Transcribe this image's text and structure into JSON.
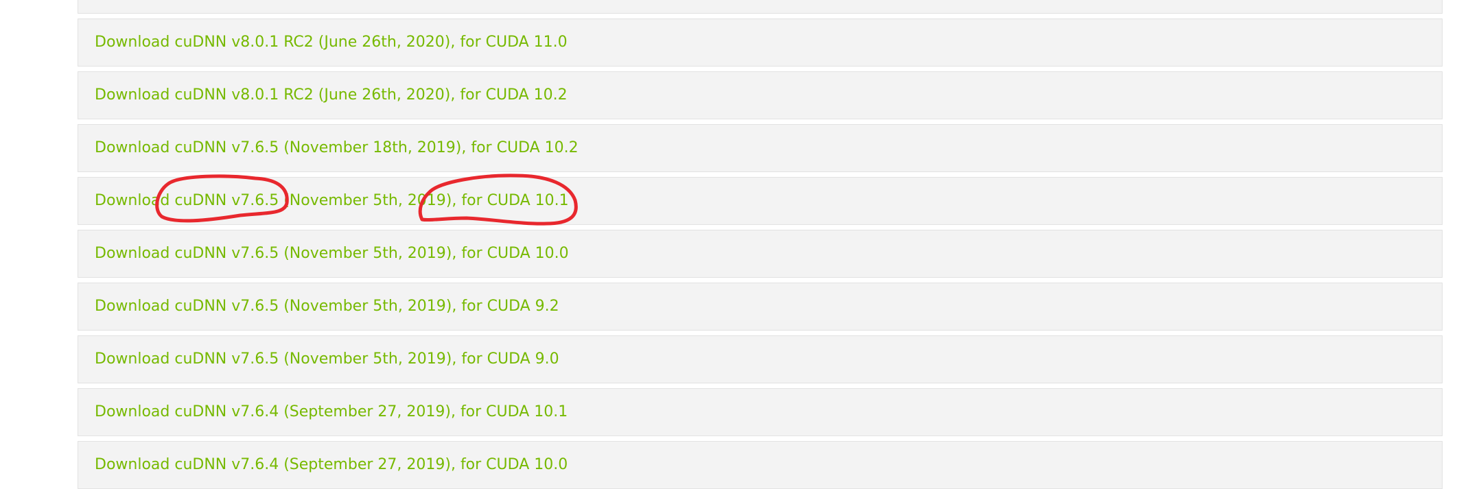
{
  "downloads": [
    {
      "label": ""
    },
    {
      "label": "Download cuDNN v8.0.1 RC2 (June 26th, 2020), for CUDA 11.0"
    },
    {
      "label": "Download cuDNN v8.0.1 RC2 (June 26th, 2020), for CUDA 10.2"
    },
    {
      "label": "Download cuDNN v7.6.5 (November 18th, 2019), for CUDA 10.2"
    },
    {
      "label": "Download cuDNN v7.6.5 (November 5th, 2019), for CUDA 10.1"
    },
    {
      "label": "Download cuDNN v7.6.5 (November 5th, 2019), for CUDA 10.0"
    },
    {
      "label": "Download cuDNN v7.6.5 (November 5th, 2019), for CUDA 9.2"
    },
    {
      "label": "Download cuDNN v7.6.5 (November 5th, 2019), for CUDA 9.0"
    },
    {
      "label": "Download cuDNN v7.6.4 (September 27, 2019), for CUDA 10.1"
    },
    {
      "label": "Download cuDNN v7.6.4 (September 27, 2019), for CUDA 10.0"
    }
  ],
  "colors": {
    "link": "#76b900",
    "row_background": "#f3f3f3",
    "annotation": "#e8282e"
  }
}
